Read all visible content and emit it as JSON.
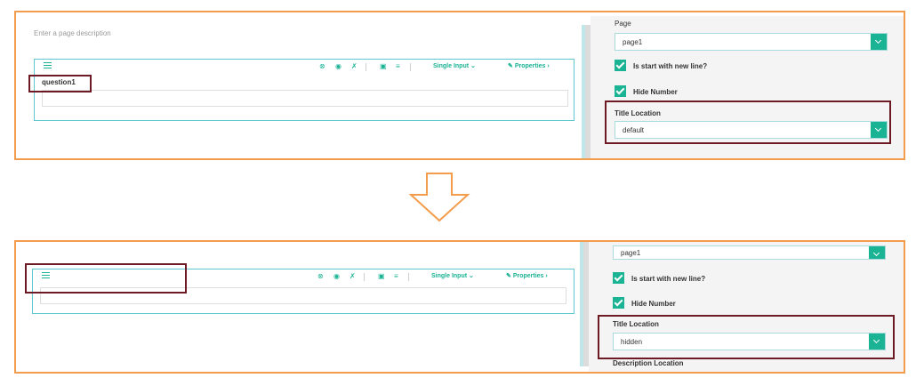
{
  "top": {
    "page_description_placeholder": "Enter a page description",
    "toolbar": {
      "question_type": "Single Input",
      "properties": "Properties"
    },
    "question_title": "question1",
    "side": {
      "page_label": "Page",
      "page_value": "page1",
      "start_new_line_label": "Is start with new line?",
      "hide_number_label": "Hide Number",
      "title_location_label": "Title Location",
      "title_location_value": "default"
    }
  },
  "arrow": {
    "color": "#f39c4c",
    "direction": "down"
  },
  "bottom": {
    "toolbar": {
      "question_type": "Single Input",
      "properties": "Properties"
    },
    "side": {
      "page_value": "page1",
      "start_new_line_label": "Is start with new line?",
      "hide_number_label": "Hide Number",
      "title_location_label": "Title Location",
      "title_location_value": "hidden",
      "description_location_label": "Description Location"
    }
  },
  "colors": {
    "accent": "#1ab394",
    "highlight": "#6e1a25",
    "frame": "#f39c4c",
    "question_border": "#5fc7cf"
  }
}
